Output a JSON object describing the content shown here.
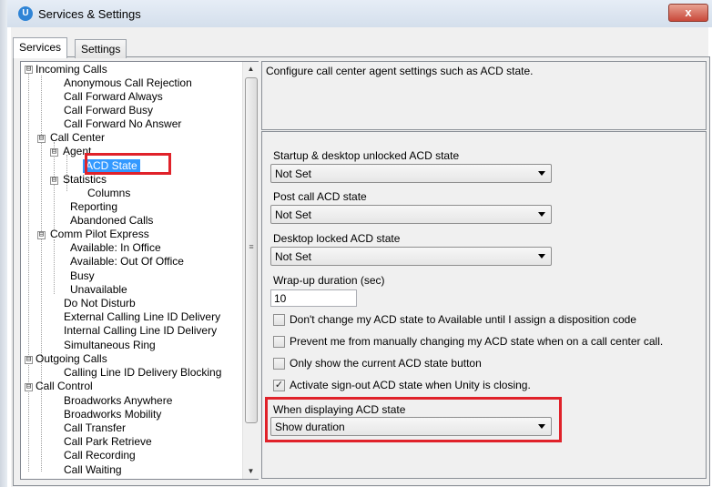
{
  "window": {
    "title": "Services & Settings",
    "close_glyph": "x"
  },
  "tabs": [
    {
      "label": "Services",
      "active": true
    },
    {
      "label": "Settings",
      "active": false
    }
  ],
  "tree": {
    "items": [
      {
        "label": "Incoming Calls"
      },
      {
        "label": "Anonymous Call Rejection"
      },
      {
        "label": "Call Forward Always"
      },
      {
        "label": "Call Forward Busy"
      },
      {
        "label": "Call Forward No Answer"
      },
      {
        "label": "Call Center"
      },
      {
        "label": "Agent"
      },
      {
        "label": "ACD State"
      },
      {
        "label": "Statistics"
      },
      {
        "label": "Columns"
      },
      {
        "label": "Reporting"
      },
      {
        "label": "Abandoned Calls"
      },
      {
        "label": "Comm Pilot Express"
      },
      {
        "label": "Available: In Office"
      },
      {
        "label": "Available: Out Of Office"
      },
      {
        "label": "Busy"
      },
      {
        "label": "Unavailable"
      },
      {
        "label": "Do Not Disturb"
      },
      {
        "label": "External Calling Line ID Delivery"
      },
      {
        "label": "Internal Calling Line ID Delivery"
      },
      {
        "label": "Simultaneous Ring"
      },
      {
        "label": "Outgoing Calls"
      },
      {
        "label": "Calling Line ID Delivery Blocking"
      },
      {
        "label": "Call Control"
      },
      {
        "label": "Broadworks Anywhere"
      },
      {
        "label": "Broadworks Mobility"
      },
      {
        "label": "Call Transfer"
      },
      {
        "label": "Call Park Retrieve"
      },
      {
        "label": "Call Recording"
      },
      {
        "label": "Call Waiting"
      }
    ],
    "expanders": [
      "⊟",
      "⊟",
      "⊟",
      "⊟",
      "⊟",
      "⊟",
      "⊟"
    ],
    "selected": "ACD State"
  },
  "description": "Configure call center agent settings such as ACD state.",
  "settings": {
    "startup_label": "Startup & desktop unlocked ACD state",
    "startup_value": "Not Set",
    "post_call_label": "Post call ACD state",
    "post_call_value": "Not Set",
    "locked_label": "Desktop locked ACD state",
    "locked_value": "Not Set",
    "wrapup_label": "Wrap-up duration (sec)",
    "wrapup_value": "10",
    "checkboxes": [
      {
        "label": "Don't change my ACD state to Available until I assign a disposition code",
        "checked": false
      },
      {
        "label": "Prevent me from manually changing my ACD state when on a call center call.",
        "checked": false
      },
      {
        "label": "Only show the current ACD state button",
        "checked": false
      },
      {
        "label": "Activate sign-out ACD state when Unity is closing.",
        "checked": true
      }
    ],
    "display_label": "When displaying ACD state",
    "display_value": "Show duration"
  },
  "icons": {
    "app": "unity-app-icon",
    "check": "✓"
  },
  "colors": {
    "highlight": "#e0222a",
    "selection": "#3399ff"
  }
}
